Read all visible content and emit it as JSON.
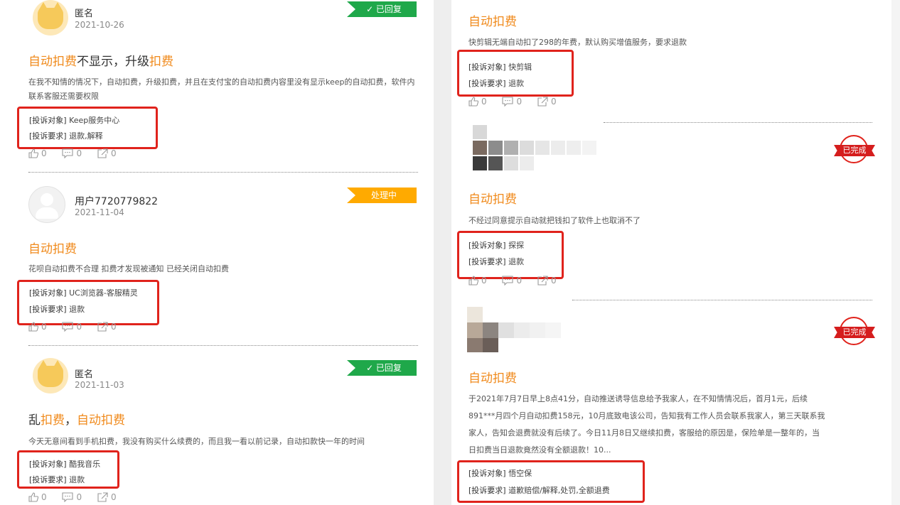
{
  "left": {
    "cards": [
      {
        "user": "匿名",
        "date": "2021-10-26",
        "badge": "✓ 已回复",
        "title_parts": [
          "自动扣费",
          "不显示，升级",
          "扣费"
        ],
        "desc": "在我不知情的情况下，自动扣费，升级扣费，并且在支付宝的自动扣费内容里没有显示keep的自动扣费，软件内联系客服还需要权限",
        "target_label": "[投诉对象]",
        "target": "Keep服务中心",
        "request_label": "[投诉要求]",
        "request": "退款,解释",
        "likes": "0",
        "comments": "0",
        "shares": "0"
      },
      {
        "user": "用户7720779822",
        "date": "2021-11-04",
        "badge": "处理中",
        "title": "自动扣费",
        "desc": "花呗自动扣费不合理 扣费才发现被通知 已经关闭自动扣费",
        "target_label": "[投诉对象]",
        "target": "UC浏览器-客服精灵",
        "request_label": "[投诉要求]",
        "request": "退款",
        "likes": "0",
        "comments": "0",
        "shares": "0"
      },
      {
        "user": "匿名",
        "date": "2021-11-03",
        "badge": "✓ 已回复",
        "title_parts": [
          "乱",
          "扣费",
          "，",
          "自动扣费"
        ],
        "desc": "今天无意间看到手机扣费，我没有购买什么续费的，而且我一看以前记录，自动扣款快一年的时间",
        "target_label": "[投诉对象]",
        "target": "酷我音乐",
        "request_label": "[投诉要求]",
        "request": "退款",
        "likes": "0",
        "comments": "0",
        "shares": "0"
      }
    ]
  },
  "right": {
    "cards": [
      {
        "title": "自动扣费",
        "desc": "快剪辑无端自动扣了298的年费，默认购买增值服务，要求退款",
        "target_label": "[投诉对象]",
        "target": "快剪辑",
        "request_label": "[投诉要求]",
        "request": "退款",
        "likes": "0",
        "comments": "0",
        "shares": "0"
      },
      {
        "stamp": "已完成",
        "title": "自动扣费",
        "desc": "不经过同意提示自动就把钱扣了软件上也取消不了",
        "target_label": "[投诉对象]",
        "target": "探探",
        "request_label": "[投诉要求]",
        "request": "退款",
        "likes": "0",
        "comments": "0",
        "shares": "0"
      },
      {
        "stamp": "已完成",
        "title": "自动扣费",
        "desc_lines": [
          "于2021年7月7日早上8点41分，自动推送诱导信息给予我家人，在不知情情况后，首月1元，后续",
          "891***月四个月自动扣费158元，10月底致电该公司，告知我有工作人员会联系我家人，第三天联系我",
          "家人，告知会退费就没有后续了。今日11月8日又继续扣费，客服给的原因是，保险单是一整年的，当",
          "日扣费当日退款竟然没有全额退款！10..."
        ],
        "target_label": "[投诉对象]",
        "target": "悟空保",
        "request_label": "[投诉要求]",
        "request": "道歉赔偿/解释,处罚,全额退费"
      }
    ]
  },
  "colors": {
    "accent": "#f08a1c",
    "replied": "#1fa84a",
    "processing": "#ffaa00",
    "highlight_box": "#e0231c"
  },
  "icons": [
    "like-icon",
    "comment-icon",
    "share-icon",
    "avatar-cat-icon",
    "avatar-user-icon",
    "check-icon",
    "completed-stamp-icon"
  ]
}
